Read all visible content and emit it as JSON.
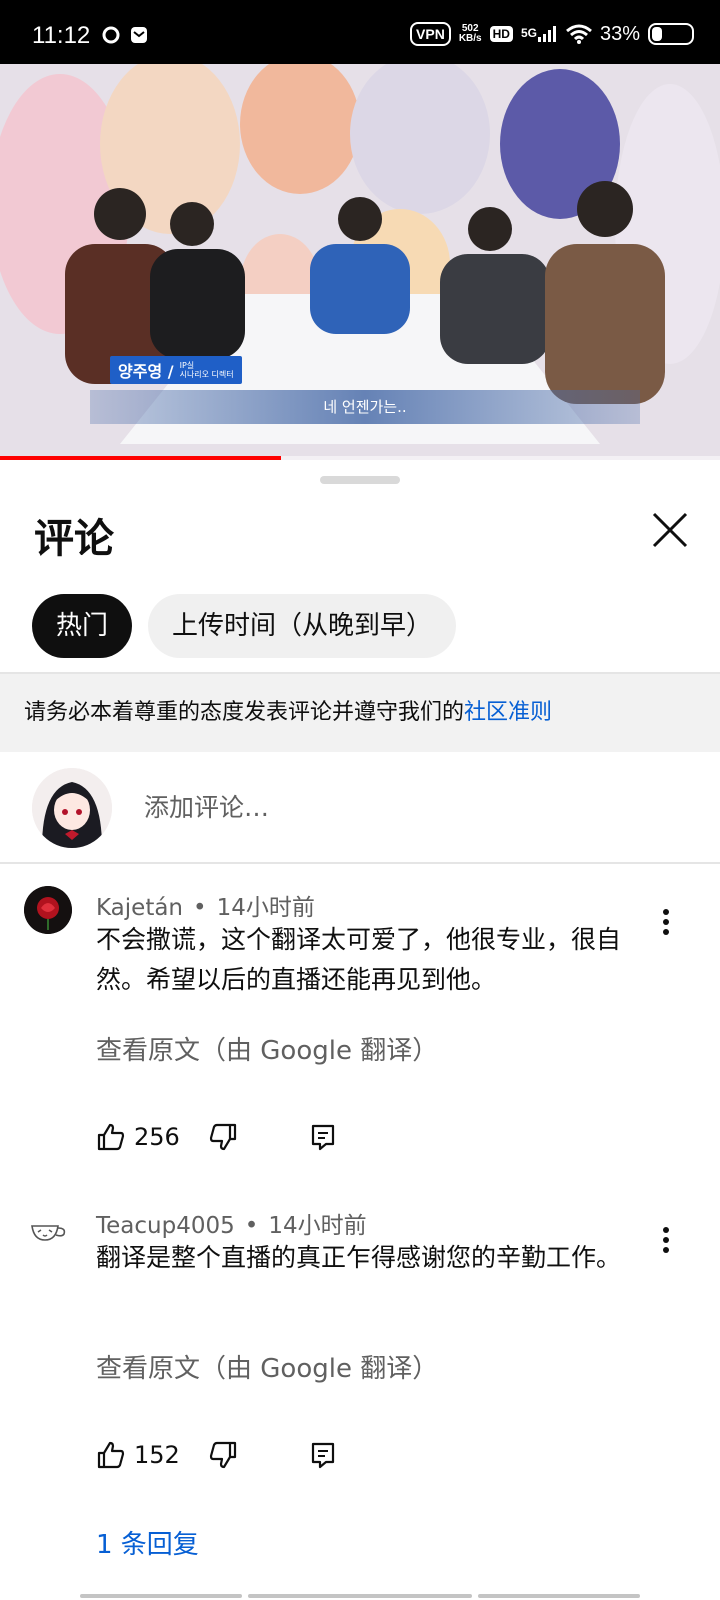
{
  "status_bar": {
    "time": "11:12",
    "vpn": "VPN",
    "speed_value": "502",
    "speed_unit": "KB/s",
    "hd": "HD",
    "network": "5G",
    "battery_percent": "33%",
    "battery_level": 0.33
  },
  "video": {
    "caption": "네 언젠가는..",
    "name_plate_name": "양주영 /",
    "name_plate_role_line1": "IP실",
    "name_plate_role_line2": "시나리오 디렉터",
    "progress": 0.39
  },
  "comments_panel": {
    "title": "评论",
    "sort_chips": [
      {
        "label": "热门",
        "active": true
      },
      {
        "label": "上传时间（从晚到早）",
        "active": false
      }
    ],
    "guideline_text": "请务必本着尊重的态度发表评论并遵守我们的",
    "guideline_link": "社区准则",
    "add_comment_placeholder": "添加评论…"
  },
  "comments": [
    {
      "author": "Kajetán",
      "time": "14小时前",
      "text": "不会撒谎，这个翻译太可爱了，他很专业，很自然。希望以后的直播还能再见到他。",
      "translate_label": "查看原文（由 Google 翻译）",
      "likes": "256"
    },
    {
      "author": "Teacup4005",
      "time": "14小时前",
      "text": "翻译是整个直播的真正乍得感谢您的辛勤工作。",
      "translate_label": "查看原文（由 Google 翻译）",
      "likes": "152",
      "replies_label": "1 条回复"
    }
  ],
  "colors": {
    "accent_link": "#065fd4",
    "progress": "#ff0000",
    "chip_active_bg": "#0f0f0f",
    "chip_bg": "#f0f0f0"
  }
}
